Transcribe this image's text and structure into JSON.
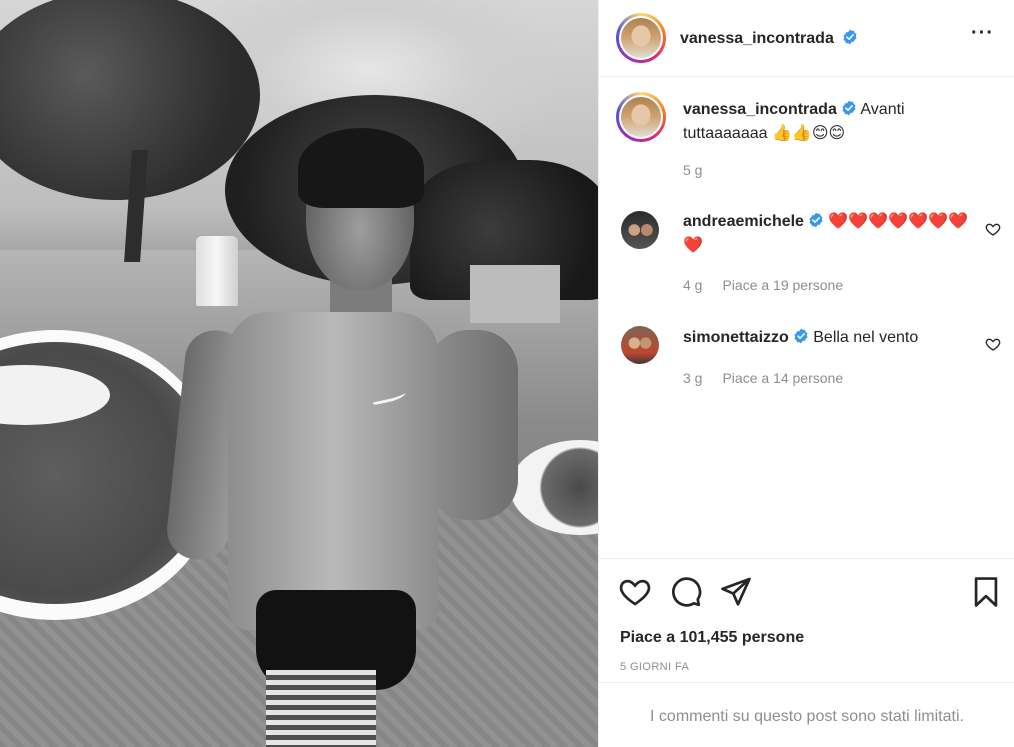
{
  "post": {
    "author": "vanessa_incontrada",
    "photo_alt": "",
    "caption_text": "Avanti tuttaaaaaaa 👍👍😊😊",
    "caption_time": "5 g"
  },
  "comments": [
    {
      "user": "andreaemichele",
      "text": "❤️❤️❤️❤️❤️❤️❤️❤️",
      "time": "4 g",
      "likes": "Piace a 19 persone"
    },
    {
      "user": "simonettaizzo",
      "text": "Bella nel vento",
      "time": "3 g",
      "likes": "Piace a 14 persone"
    }
  ],
  "footer": {
    "likes": "Piace a 101,455 persone",
    "date": "5 GIORNI FA",
    "comments_limited": "I commenti su questo post sono stati limitati."
  },
  "colors": {
    "verified": "#3897f0",
    "text": "#262626",
    "muted": "#8e8e8e",
    "border": "#efefef"
  },
  "icons": [
    "more-icon",
    "heart-icon",
    "comment-icon",
    "share-icon",
    "bookmark-icon",
    "verified-icon",
    "like-small-icon"
  ]
}
